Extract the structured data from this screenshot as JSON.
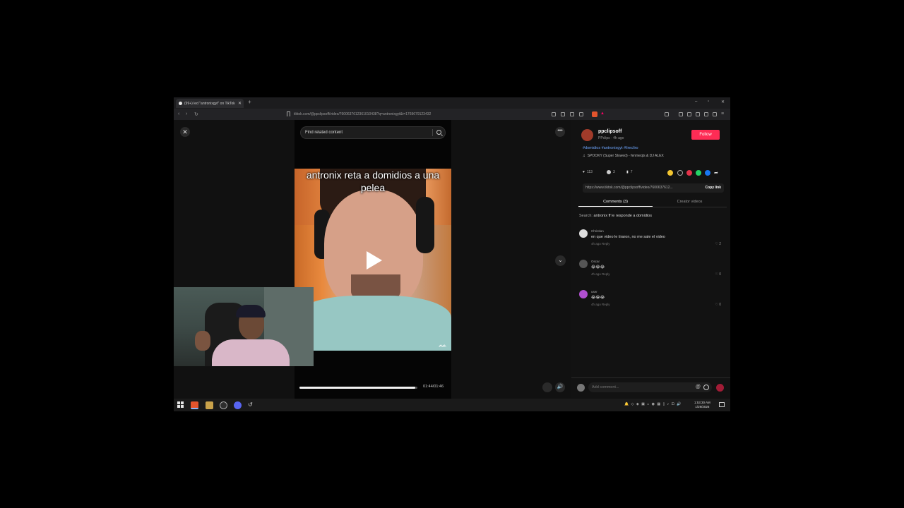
{
  "browser": {
    "tab_title": "(99+) led \"antronixgyt\" on TikTok",
    "new_tab": "+",
    "url": "tiktok.com/@ppclipsoff/video/7600637612361010438?q=antronixgyt&t=1769679123432",
    "window_controls": [
      "–",
      "▫",
      "✕"
    ]
  },
  "video": {
    "search_placeholder": "Find related content",
    "caption": "antronix reta a domidios a una pelea",
    "progress": 0.985,
    "time": "01:44/01:46",
    "close_label": "✕",
    "more_label": "•••",
    "down_label": "⌄",
    "volume_label": "🔊"
  },
  "post": {
    "author": "ppclipsoff",
    "author_sub": "PPclips · 4h ago",
    "follow": "Follow",
    "hashtags": "#domidios #antronixgyt #lirecliro",
    "music": "SPOOKY (Super Slowed) - fenmeqts & DJ ALEX",
    "likes": "113",
    "comments_count": "3",
    "saves": "7",
    "link": "https://www.tiktok.com/@ppclipsoff/video/7600637612...",
    "copy_link": "Copy link",
    "tab_comments": "Comments (3)",
    "tab_creator": "Creator videos",
    "search_hint_prefix": "Search:",
    "search_hint_query": "antronix ff le responde a domidios"
  },
  "comments": [
    {
      "name": "Christian",
      "text": "en que video le tiraron, no me sale el video",
      "meta": "4h ago   Reply",
      "likes": "2"
    },
    {
      "name": "Oscar",
      "text": "😂😂😂",
      "meta": "4h ago   Reply",
      "likes": "0"
    },
    {
      "name": "user",
      "text": "😂😂😂",
      "meta": "4h ago   Reply",
      "likes": "0"
    }
  ],
  "comment_bar": {
    "placeholder": "Add comment...",
    "at": "@"
  },
  "taskbar": {
    "tray": "🔔 ◇ ◈ ▣ ⌂ ◉ ▦ ▯ ♪ ⊡ 🔊",
    "time": "1:53:30 AM",
    "date": "1/29/2026"
  },
  "colors": {
    "follow": "#fe2c55",
    "hashtag": "#6ea6ff",
    "background": "#121212"
  }
}
